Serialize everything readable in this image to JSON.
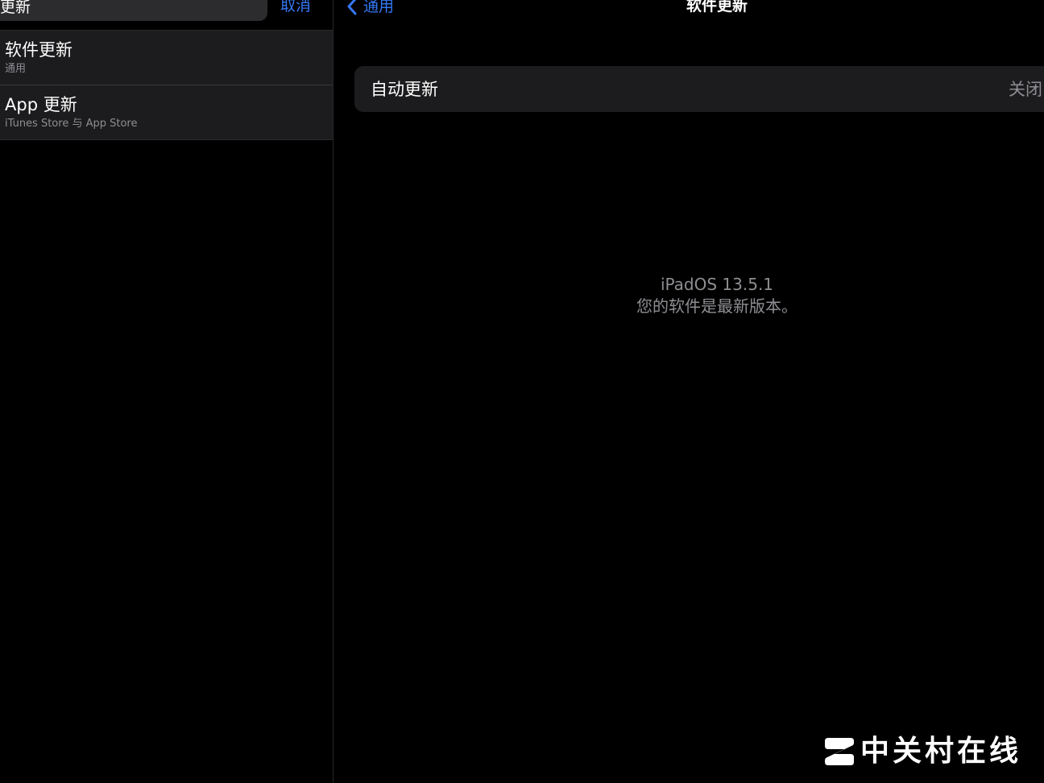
{
  "search": {
    "query": "更新",
    "clear_icon": "clear-circle-icon",
    "cancel_label": "取消"
  },
  "results": [
    {
      "title": "软件更新",
      "subtitle": "通用"
    },
    {
      "title": "App 更新",
      "subtitle": "iTunes Store 与 App Store"
    }
  ],
  "nav": {
    "back_label": "通用",
    "back_icon": "chevron-left-icon",
    "title": "软件更新"
  },
  "auto_update": {
    "label": "自动更新",
    "value": "关闭"
  },
  "status": {
    "version": "iPadOS 13.5.1",
    "message": "您的软件是最新版本。"
  },
  "watermark": {
    "text": "中关村在线"
  },
  "colors": {
    "accent": "#3478f6",
    "background": "#000000",
    "cell": "#1c1c1e",
    "secondary_text": "#8e8e93"
  }
}
